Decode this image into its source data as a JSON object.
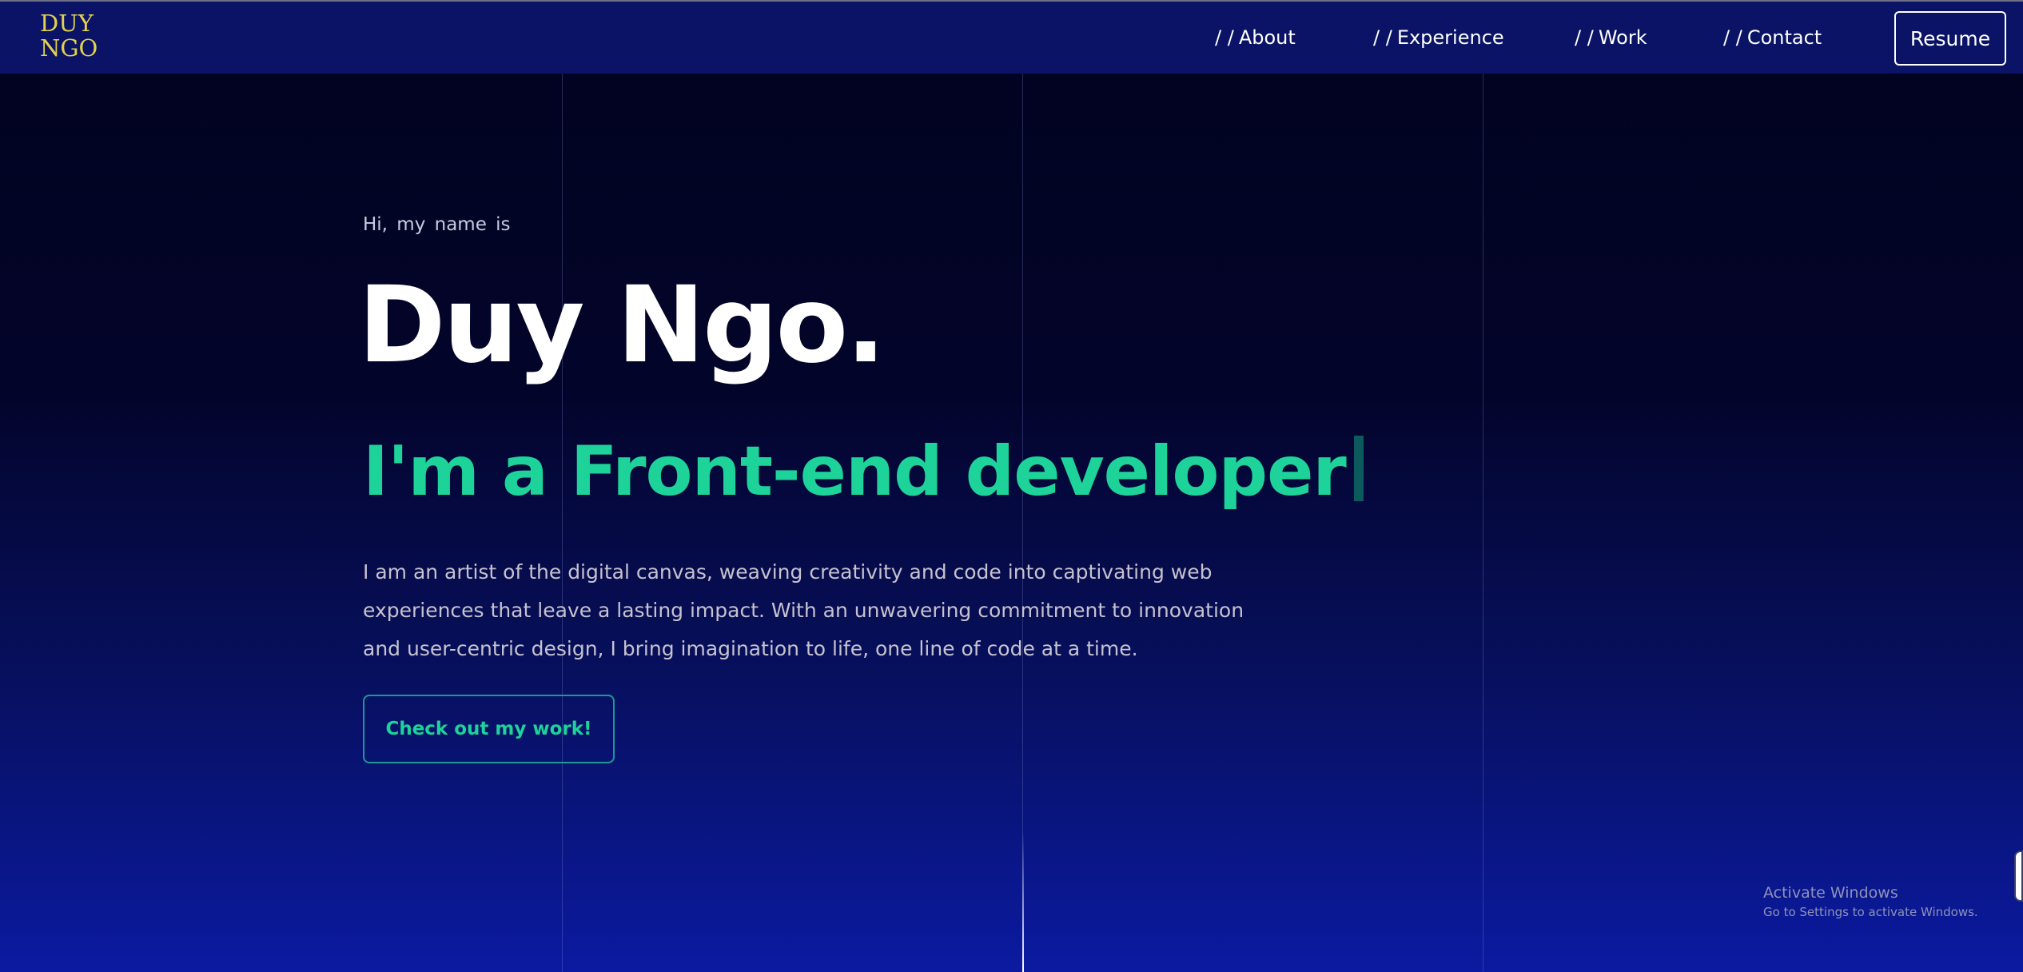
{
  "logo": {
    "line1": "DUY",
    "line2": "NGO"
  },
  "nav": {
    "items": [
      {
        "prefix": "/ /",
        "label": "About"
      },
      {
        "prefix": "/ /",
        "label": "Experience"
      },
      {
        "prefix": "/ /",
        "label": "Work"
      },
      {
        "prefix": "/ /",
        "label": "Contact"
      }
    ],
    "resume_label": "Resume"
  },
  "hero": {
    "greeting": "Hi, my name is",
    "name": "Duy Ngo.",
    "role": "I'm a Front-end developer",
    "bio": "I am an artist of the digital canvas, weaving creativity and code into captivating web experiences that leave a lasting impact. With an unwavering commitment to innovation and user-centric design, I bring imagination to life, one line of code at a time.",
    "cta_label": "Check out my work!"
  },
  "watermark": {
    "title": "Activate Windows",
    "subtitle": "Go to Settings to activate Windows."
  },
  "colors": {
    "accent": "#1ed39a",
    "logo": "#e3d24e",
    "nav_bg": "#0a1366"
  }
}
